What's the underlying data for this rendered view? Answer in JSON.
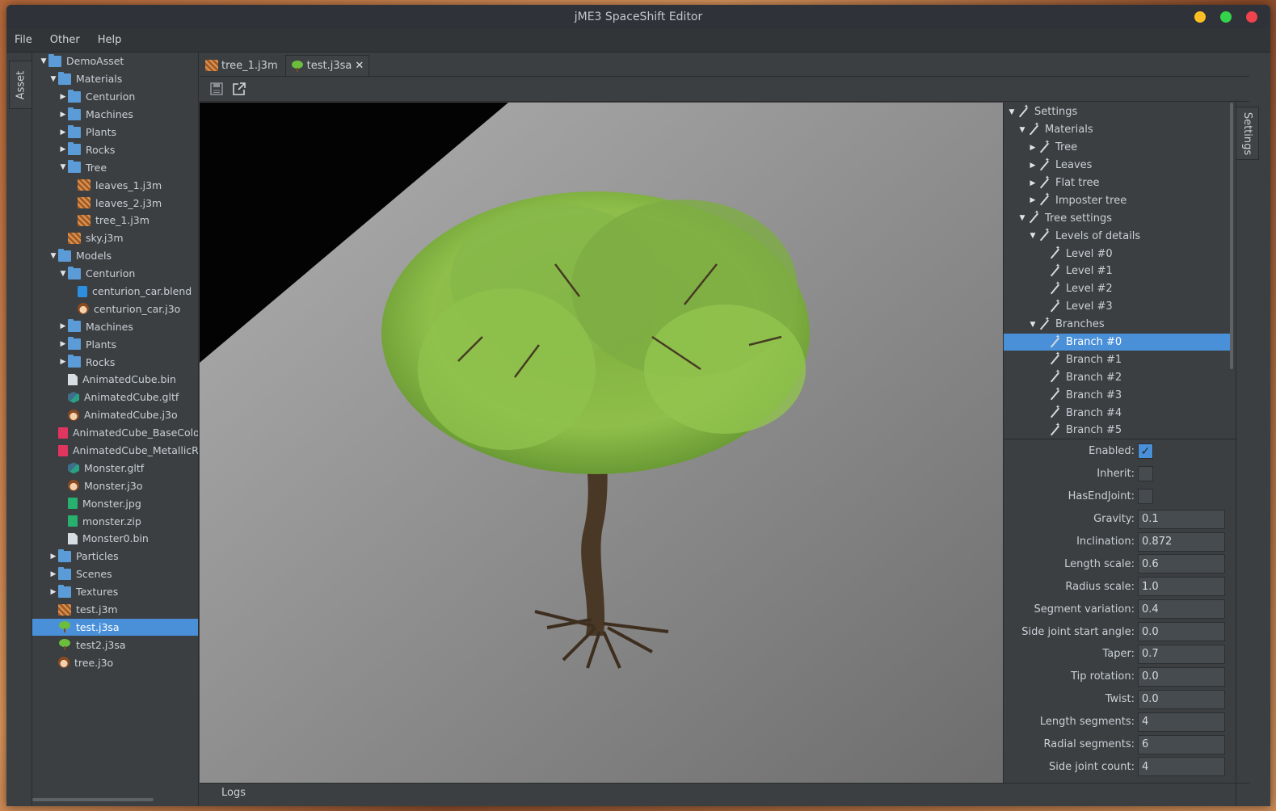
{
  "window": {
    "title": "jME3 SpaceShift Editor",
    "controls": {
      "minimize_color": "#fbbf24",
      "maximize_color": "#34d34a",
      "close_color": "#f0434d"
    }
  },
  "menu": [
    "File",
    "Other",
    "Help"
  ],
  "left_tab": "Asset",
  "right_tab": "Settings",
  "asset_tree": [
    {
      "label": "DemoAsset",
      "icon": "folder",
      "depth": 0,
      "arrow": "expanded"
    },
    {
      "label": "Materials",
      "icon": "folder",
      "depth": 1,
      "arrow": "expanded"
    },
    {
      "label": "Centurion",
      "icon": "folder",
      "depth": 2,
      "arrow": "collapsed"
    },
    {
      "label": "Machines",
      "icon": "folder",
      "depth": 2,
      "arrow": "collapsed"
    },
    {
      "label": "Plants",
      "icon": "folder",
      "depth": 2,
      "arrow": "collapsed"
    },
    {
      "label": "Rocks",
      "icon": "folder",
      "depth": 2,
      "arrow": "collapsed"
    },
    {
      "label": "Tree",
      "icon": "folder",
      "depth": 2,
      "arrow": "expanded"
    },
    {
      "label": "leaves_1.j3m",
      "icon": "material",
      "depth": 3,
      "arrow": "none"
    },
    {
      "label": "leaves_2.j3m",
      "icon": "material",
      "depth": 3,
      "arrow": "none"
    },
    {
      "label": "tree_1.j3m",
      "icon": "material",
      "depth": 3,
      "arrow": "none"
    },
    {
      "label": "sky.j3m",
      "icon": "material",
      "depth": 2,
      "arrow": "none"
    },
    {
      "label": "Models",
      "icon": "folder",
      "depth": 1,
      "arrow": "expanded"
    },
    {
      "label": "Centurion",
      "icon": "folder",
      "depth": 2,
      "arrow": "expanded"
    },
    {
      "label": "centurion_car.blend",
      "icon": "blend",
      "depth": 3,
      "arrow": "none"
    },
    {
      "label": "centurion_car.j3o",
      "icon": "model",
      "depth": 3,
      "arrow": "none"
    },
    {
      "label": "Machines",
      "icon": "folder",
      "depth": 2,
      "arrow": "collapsed"
    },
    {
      "label": "Plants",
      "icon": "folder",
      "depth": 2,
      "arrow": "collapsed"
    },
    {
      "label": "Rocks",
      "icon": "folder",
      "depth": 2,
      "arrow": "collapsed"
    },
    {
      "label": "AnimatedCube.bin",
      "icon": "binary",
      "depth": 2,
      "arrow": "none"
    },
    {
      "label": "AnimatedCube.gltf",
      "icon": "gltf",
      "depth": 2,
      "arrow": "none"
    },
    {
      "label": "AnimatedCube.j3o",
      "icon": "model",
      "depth": 2,
      "arrow": "none"
    },
    {
      "label": "AnimatedCube_BaseColor",
      "icon": "image-red",
      "depth": 2,
      "arrow": "none"
    },
    {
      "label": "AnimatedCube_MetallicR",
      "icon": "image-red",
      "depth": 2,
      "arrow": "none"
    },
    {
      "label": "Monster.gltf",
      "icon": "gltf",
      "depth": 2,
      "arrow": "none"
    },
    {
      "label": "Monster.j3o",
      "icon": "model",
      "depth": 2,
      "arrow": "none"
    },
    {
      "label": "Monster.jpg",
      "icon": "image-green",
      "depth": 2,
      "arrow": "none"
    },
    {
      "label": "monster.zip",
      "icon": "image-green",
      "depth": 2,
      "arrow": "none"
    },
    {
      "label": "Monster0.bin",
      "icon": "binary",
      "depth": 2,
      "arrow": "none"
    },
    {
      "label": "Particles",
      "icon": "folder",
      "depth": 1,
      "arrow": "collapsed"
    },
    {
      "label": "Scenes",
      "icon": "folder",
      "depth": 1,
      "arrow": "collapsed"
    },
    {
      "label": "Textures",
      "icon": "folder",
      "depth": 1,
      "arrow": "collapsed"
    },
    {
      "label": "test.j3m",
      "icon": "material",
      "depth": 1,
      "arrow": "none"
    },
    {
      "label": "test.j3sa",
      "icon": "tree",
      "depth": 1,
      "arrow": "none",
      "selected": true
    },
    {
      "label": "test2.j3sa",
      "icon": "tree",
      "depth": 1,
      "arrow": "none"
    },
    {
      "label": "tree.j3o",
      "icon": "model",
      "depth": 1,
      "arrow": "none"
    }
  ],
  "editor_tabs": [
    {
      "label": "tree_1.j3m",
      "icon": "material",
      "active": false
    },
    {
      "label": "test.j3sa",
      "icon": "tree",
      "active": true,
      "close": "✕"
    }
  ],
  "toolbar": [
    "save-icon",
    "open-external-icon"
  ],
  "logs_label": "Logs",
  "settings_tree": [
    {
      "label": "Settings",
      "depth": 0,
      "arrow": "expanded"
    },
    {
      "label": "Materials",
      "depth": 1,
      "arrow": "expanded"
    },
    {
      "label": "Tree",
      "depth": 2,
      "arrow": "collapsed"
    },
    {
      "label": "Leaves",
      "depth": 2,
      "arrow": "collapsed"
    },
    {
      "label": "Flat tree",
      "depth": 2,
      "arrow": "collapsed"
    },
    {
      "label": "Imposter tree",
      "depth": 2,
      "arrow": "collapsed"
    },
    {
      "label": "Tree settings",
      "depth": 1,
      "arrow": "expanded"
    },
    {
      "label": "Levels of details",
      "depth": 2,
      "arrow": "expanded"
    },
    {
      "label": "Level #0",
      "depth": 3,
      "arrow": "none"
    },
    {
      "label": "Level #1",
      "depth": 3,
      "arrow": "none"
    },
    {
      "label": "Level #2",
      "depth": 3,
      "arrow": "none"
    },
    {
      "label": "Level #3",
      "depth": 3,
      "arrow": "none"
    },
    {
      "label": "Branches",
      "depth": 2,
      "arrow": "expanded"
    },
    {
      "label": "Branch #0",
      "depth": 3,
      "arrow": "none",
      "selected": true
    },
    {
      "label": "Branch #1",
      "depth": 3,
      "arrow": "none"
    },
    {
      "label": "Branch #2",
      "depth": 3,
      "arrow": "none"
    },
    {
      "label": "Branch #3",
      "depth": 3,
      "arrow": "none"
    },
    {
      "label": "Branch #4",
      "depth": 3,
      "arrow": "none"
    },
    {
      "label": "Branch #5",
      "depth": 3,
      "arrow": "none"
    }
  ],
  "properties": [
    {
      "label": "Enabled:",
      "type": "checkbox",
      "value": true
    },
    {
      "label": "Inherit:",
      "type": "checkbox",
      "value": false
    },
    {
      "label": "HasEndJoint:",
      "type": "checkbox",
      "value": false
    },
    {
      "label": "Gravity:",
      "type": "text",
      "value": "0.1"
    },
    {
      "label": "Inclination:",
      "type": "text",
      "value": "0.872"
    },
    {
      "label": "Length scale:",
      "type": "text",
      "value": "0.6"
    },
    {
      "label": "Radius scale:",
      "type": "text",
      "value": "1.0"
    },
    {
      "label": "Segment variation:",
      "type": "text",
      "value": "0.4"
    },
    {
      "label": "Side joint start angle:",
      "type": "text",
      "value": "0.0"
    },
    {
      "label": "Taper:",
      "type": "text",
      "value": "0.7"
    },
    {
      "label": "Tip rotation:",
      "type": "text",
      "value": "0.0"
    },
    {
      "label": "Twist:",
      "type": "text",
      "value": "0.0"
    },
    {
      "label": "Length segments:",
      "type": "text",
      "value": "4"
    },
    {
      "label": "Radial segments:",
      "type": "text",
      "value": "6"
    },
    {
      "label": "Side joint count:",
      "type": "text",
      "value": "4"
    }
  ],
  "colors": {
    "selection": "#4a90d9",
    "panel_bg": "#3b3f42",
    "titlebar_bg": "#2f3339"
  }
}
